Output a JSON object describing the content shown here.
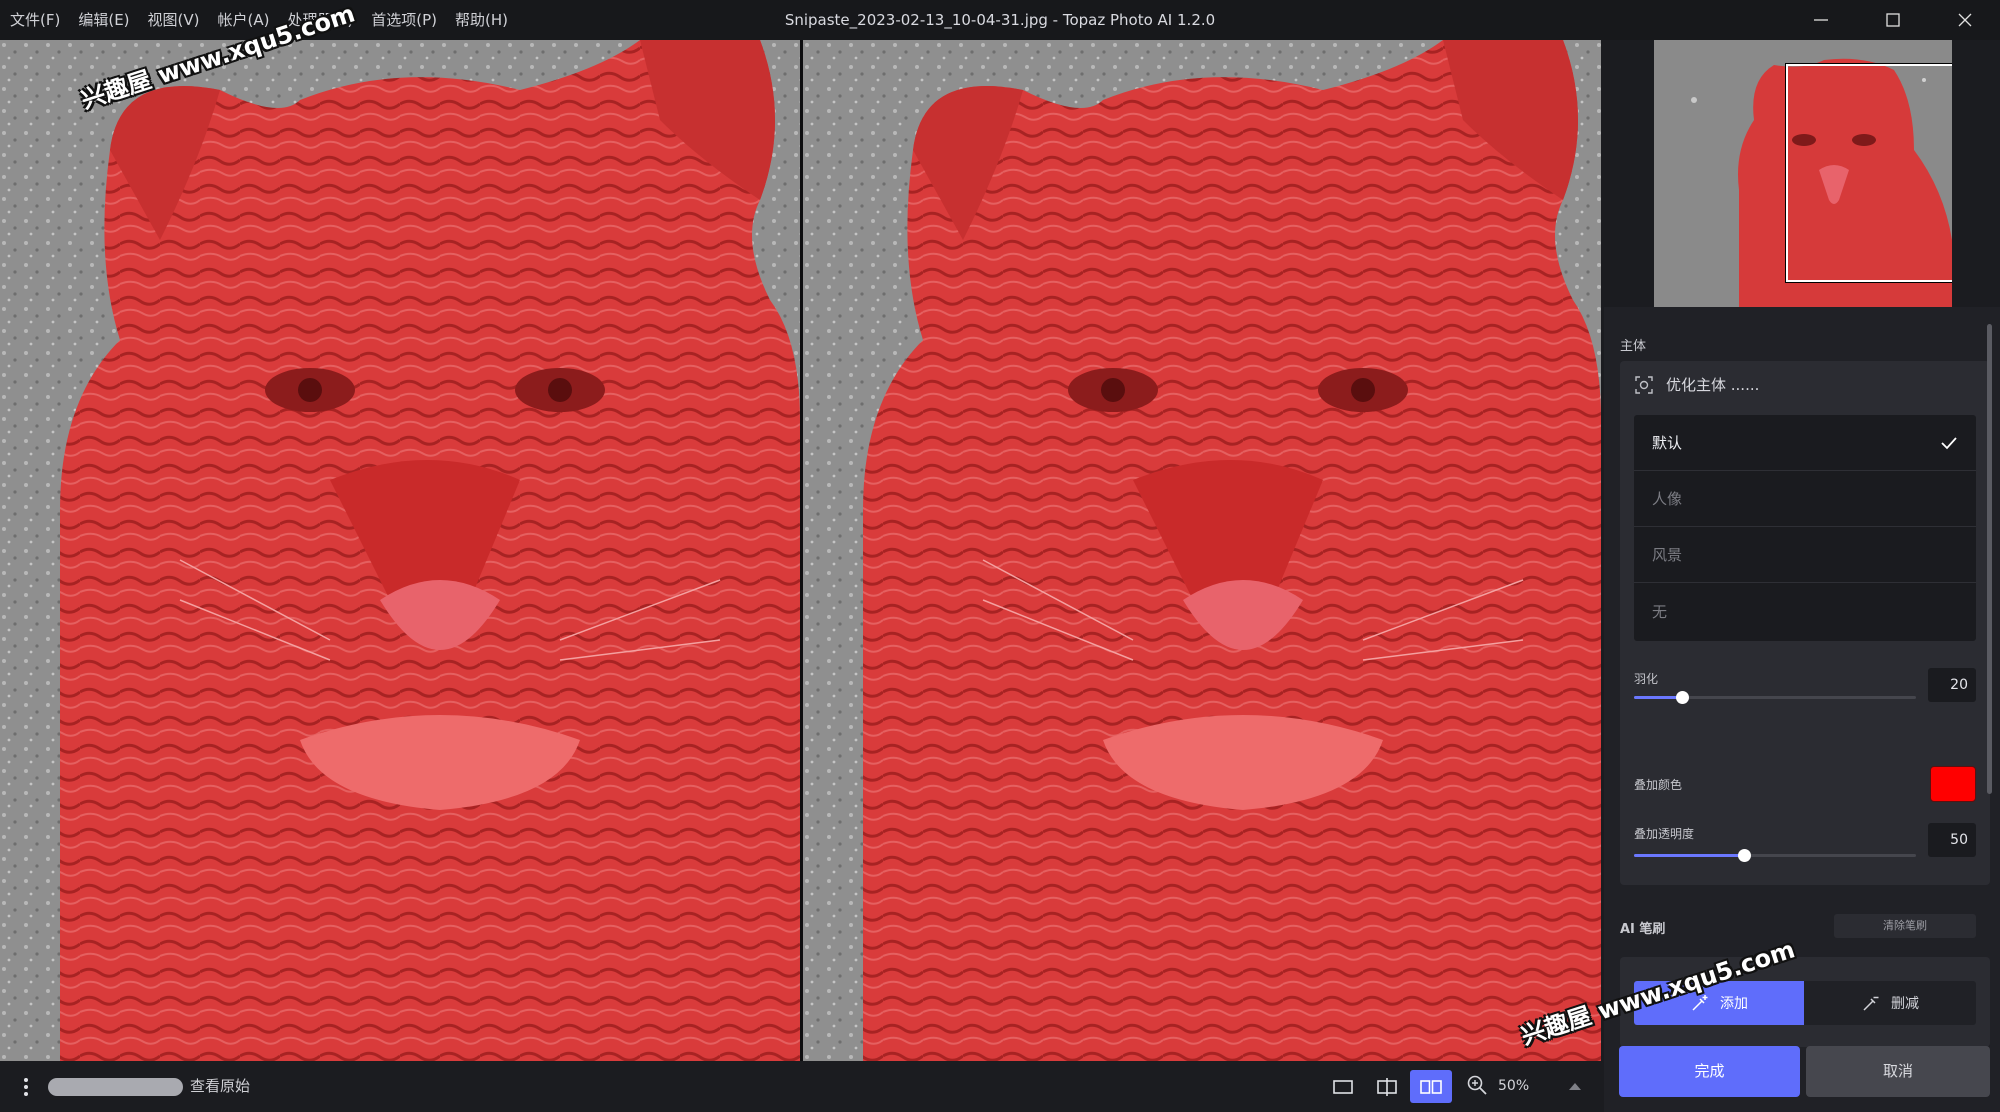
{
  "menu": [
    "文件(F)",
    "编辑(E)",
    "视图(V)",
    "帐户(A)",
    "处理器(P)",
    "首选项(P)",
    "帮助(H)"
  ],
  "window": {
    "title": "Snipaste_2023-02-13_10-04-31.jpg - Topaz Photo AI 1.2.0"
  },
  "watermark": "兴趣屋 www.xqu5.com",
  "panel": {
    "subject_section": "主体",
    "refine_label": "优化主体 ......",
    "options": [
      {
        "label": "默认",
        "selected": true
      },
      {
        "label": "人像",
        "selected": false
      },
      {
        "label": "风景",
        "selected": false
      },
      {
        "label": "无",
        "selected": false
      }
    ],
    "feather": {
      "label": "羽化",
      "value": "20",
      "level": 0.17
    },
    "overlay_color": {
      "label": "叠加颜色",
      "color": "#ff0000"
    },
    "overlay_opacity": {
      "label": "叠加透明度",
      "value": "50",
      "level": 0.39
    },
    "ai_brush": {
      "title": "AI 笔刷",
      "clear": "清除笔刷",
      "add": "添加",
      "subtract": "删减"
    },
    "done": "完成",
    "cancel": "取消"
  },
  "bottom": {
    "view_original": "查看原始",
    "zoom": "50%"
  },
  "colors": {
    "accent": "#5f6dfb",
    "mask": "#e23a3a",
    "background": "#1b1c20"
  }
}
